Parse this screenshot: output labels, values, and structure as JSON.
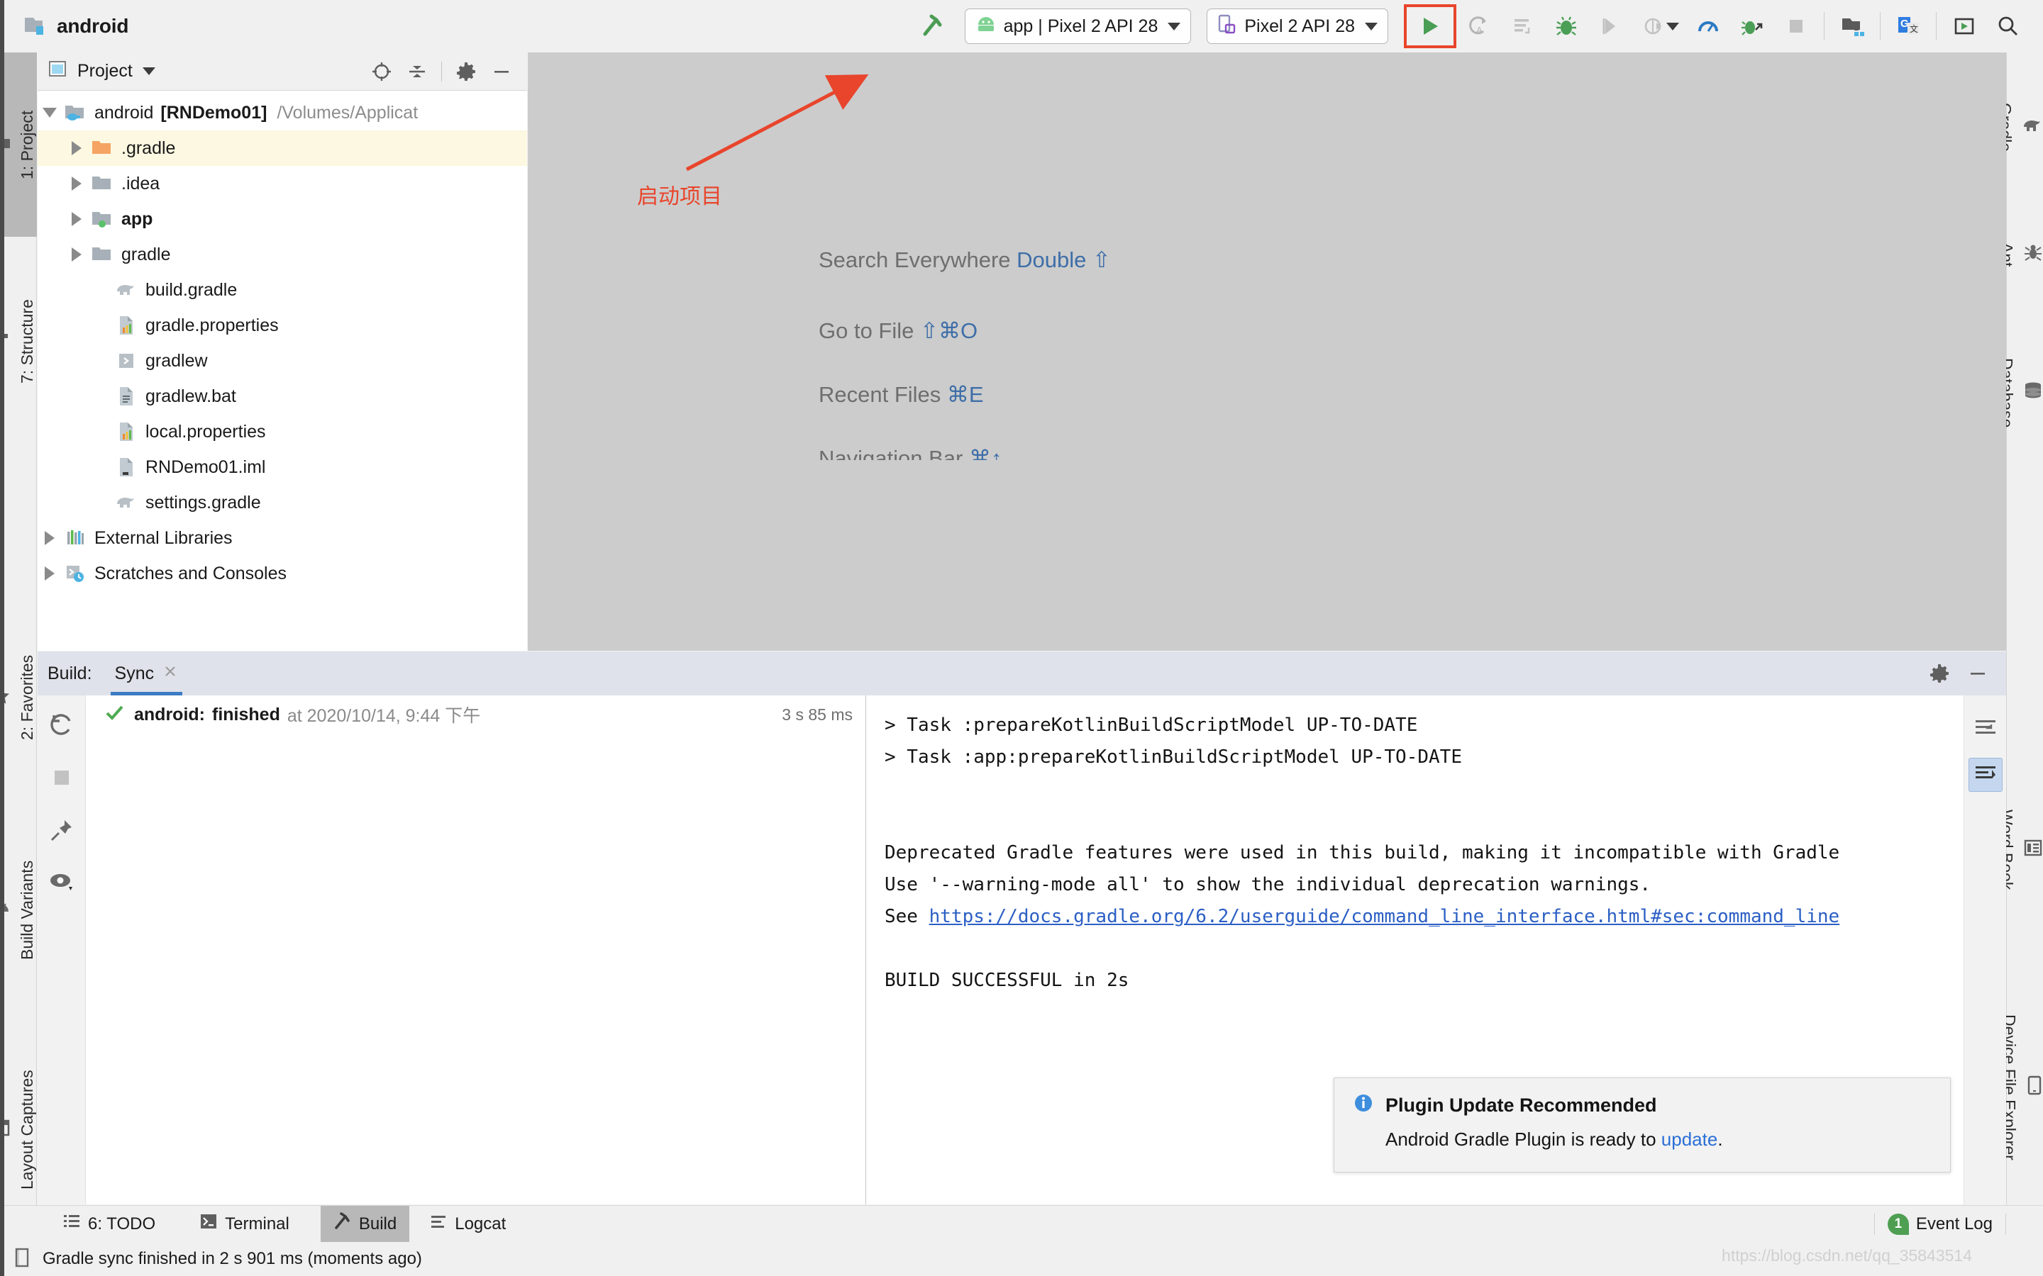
{
  "titlebar": {
    "project_name": "android",
    "folder_icon": "folder-icon",
    "build_icon": "hammer-icon",
    "run_config": {
      "label": "app | Pixel 2 API 28",
      "icon": "android-robot-icon"
    },
    "device": {
      "label": "Pixel 2 API 28",
      "icon": "device-phone-icon"
    },
    "actions": [
      {
        "name": "run-button",
        "icon": "play-icon"
      },
      {
        "name": "apply-changes-button",
        "icon": "apply-changes-icon"
      },
      {
        "name": "apply-code-changes-button",
        "icon": "apply-code-changes-icon"
      },
      {
        "name": "debug-button",
        "icon": "bug-icon"
      },
      {
        "name": "run-coverage-button",
        "icon": "run-coverage-icon"
      },
      {
        "name": "profile-button",
        "icon": "profile-icon"
      },
      {
        "name": "profiler-button",
        "icon": "profiler-monitor-icon"
      },
      {
        "name": "attach-debugger-button",
        "icon": "attach-debugger-icon"
      },
      {
        "name": "stop-button",
        "icon": "stop-square-icon"
      },
      {
        "name": "avd-manager-button",
        "icon": "avd-manager-icon"
      },
      {
        "name": "translate-button",
        "icon": "google-translate-icon"
      },
      {
        "name": "sdk-manager-button",
        "icon": "sdk-manager-icon"
      },
      {
        "name": "search-button",
        "icon": "search-icon"
      }
    ]
  },
  "annotation": {
    "text": "启动项目",
    "color": "#e8452c"
  },
  "left_toolwindows": [
    {
      "label": "1: Project",
      "icon": "folder-icon",
      "active": true
    },
    {
      "label": "7: Structure",
      "icon": "structure-icon",
      "active": false
    },
    {
      "label": "2: Favorites",
      "icon": "star-icon",
      "active": false
    },
    {
      "label": "Build Variants",
      "icon": "android-robot-icon",
      "active": false
    },
    {
      "label": "Layout Captures",
      "icon": "layout-captures-icon",
      "active": false
    }
  ],
  "right_toolwindows": [
    {
      "label": "Gradle",
      "icon": "gradle-elephant-icon"
    },
    {
      "label": "Ant",
      "icon": "ant-icon"
    },
    {
      "label": "Database",
      "icon": "database-icon"
    },
    {
      "label": "Word Book",
      "icon": "word-book-icon"
    },
    {
      "label": "Device File Explorer",
      "icon": "device-file-explorer-icon"
    }
  ],
  "project_panel": {
    "title": "Project",
    "header_actions": [
      {
        "name": "select-opened-file-button",
        "icon": "target-crosshair-icon"
      },
      {
        "name": "collapse-all-button",
        "icon": "collapse-all-icon"
      },
      {
        "name": "settings-button",
        "icon": "gear-icon"
      },
      {
        "name": "hide-button",
        "icon": "minimize-icon"
      }
    ],
    "tree": [
      {
        "label": "android",
        "bold_suffix": "[RNDemo01]",
        "path": "/Volumes/Applicat",
        "icon": "module-folder-icon",
        "indent": 0,
        "expanded": true,
        "has_arrow": true,
        "highlight": false
      },
      {
        "label": ".gradle",
        "icon": "orange-folder-icon",
        "indent": 1,
        "expanded": false,
        "has_arrow": true,
        "highlight": true
      },
      {
        "label": ".idea",
        "icon": "folder-icon",
        "indent": 1,
        "expanded": false,
        "has_arrow": true,
        "highlight": false
      },
      {
        "label": "app",
        "bold": true,
        "icon": "module-app-icon",
        "indent": 1,
        "expanded": false,
        "has_arrow": true,
        "highlight": false
      },
      {
        "label": "gradle",
        "icon": "folder-icon",
        "indent": 1,
        "expanded": false,
        "has_arrow": true,
        "highlight": false
      },
      {
        "label": "build.gradle",
        "icon": "gradle-file-icon",
        "indent": 2,
        "has_arrow": false,
        "highlight": false
      },
      {
        "label": "gradle.properties",
        "icon": "properties-file-icon",
        "indent": 2,
        "has_arrow": false,
        "highlight": false
      },
      {
        "label": "gradlew",
        "icon": "shell-script-icon",
        "indent": 2,
        "has_arrow": false,
        "highlight": false
      },
      {
        "label": "gradlew.bat",
        "icon": "text-file-icon",
        "indent": 2,
        "has_arrow": false,
        "highlight": false
      },
      {
        "label": "local.properties",
        "icon": "properties-file-icon",
        "indent": 2,
        "has_arrow": false,
        "highlight": false
      },
      {
        "label": "RNDemo01.iml",
        "icon": "iml-file-icon",
        "indent": 2,
        "has_arrow": false,
        "highlight": false
      },
      {
        "label": "settings.gradle",
        "icon": "gradle-file-icon",
        "indent": 2,
        "has_arrow": false,
        "highlight": false
      },
      {
        "label": "External Libraries",
        "icon": "libraries-icon",
        "indent": 0,
        "expanded": false,
        "has_arrow": true,
        "highlight": false
      },
      {
        "label": "Scratches and Consoles",
        "icon": "scratches-icon",
        "indent": 0,
        "expanded": false,
        "has_arrow": true,
        "highlight": false
      }
    ]
  },
  "editor_hints": [
    {
      "action": "Search Everywhere",
      "shortcut": "Double ⇧"
    },
    {
      "action": "Go to File",
      "shortcut": "⇧⌘O"
    },
    {
      "action": "Recent Files",
      "shortcut": "⌘E"
    },
    {
      "action": "Navigation Bar",
      "shortcut": "⌘↑"
    }
  ],
  "build_panel": {
    "label": "Build:",
    "tab": {
      "label": "Sync",
      "close_icon": "close-icon"
    },
    "header_actions": [
      {
        "name": "build-settings-button",
        "icon": "gear-icon"
      },
      {
        "name": "build-hide-button",
        "icon": "minimize-icon"
      }
    ],
    "tool_buttons": [
      {
        "name": "rerun-button",
        "icon": "refresh-icon"
      },
      {
        "name": "stop-button",
        "icon": "stop-square-icon"
      },
      {
        "name": "pin-tab-button",
        "icon": "pin-icon"
      },
      {
        "name": "filter-button",
        "icon": "eye-icon"
      }
    ],
    "tree_row": {
      "status_icon": "check-icon",
      "name": "android:",
      "state": "finished",
      "at": "at 2020/10/14, 9:44 下午",
      "duration": "3 s 85 ms"
    },
    "console_lines": [
      {
        "text": "> Task :prepareKotlinBuildScriptModel UP-TO-DATE"
      },
      {
        "text": "> Task :app:prepareKotlinBuildScriptModel UP-TO-DATE"
      },
      {
        "text": ""
      },
      {
        "text": ""
      },
      {
        "text": "Deprecated Gradle features were used in this build, making it incompatible with Gradle"
      },
      {
        "text": "Use '--warning-mode all' to show the individual deprecation warnings."
      },
      {
        "prefix": "See ",
        "link": "https://docs.gradle.org/6.2/userguide/command_line_interface.html#sec:command_line"
      },
      {
        "text": ""
      },
      {
        "text": "BUILD SUCCESSFUL in 2s"
      }
    ],
    "console_side_actions": [
      {
        "name": "soft-wrap-button",
        "icon": "soft-wrap-icon",
        "active": false
      },
      {
        "name": "scroll-to-end-button",
        "icon": "scroll-to-end-icon",
        "active": true
      }
    ]
  },
  "notification": {
    "icon": "info-icon",
    "title": "Plugin Update Recommended",
    "body_prefix": "Android Gradle Plugin is ready to ",
    "link": "update",
    "body_suffix": "."
  },
  "bottom_bar": {
    "items": [
      {
        "label": "6: TODO",
        "icon": "todo-list-icon",
        "active": false
      },
      {
        "label": "Terminal",
        "icon": "terminal-icon",
        "active": false
      },
      {
        "label": "Build",
        "icon": "hammer-icon",
        "active": true
      },
      {
        "label": "Logcat",
        "icon": "logcat-icon",
        "active": false
      }
    ],
    "event_log": {
      "label": "Event Log",
      "count": "1"
    }
  },
  "status_bar": {
    "icon": "document-icon",
    "text": "Gradle sync finished in 2 s 901 ms (moments ago)"
  },
  "watermark": "https://blog.csdn.net/qq_35843514",
  "colors": {
    "accent_blue": "#3b7cc4",
    "annotation_red": "#e8452c",
    "success_green": "#4f9f53",
    "link_blue": "#2b5fc4",
    "highlight_yellow": "#fcf8e1"
  }
}
